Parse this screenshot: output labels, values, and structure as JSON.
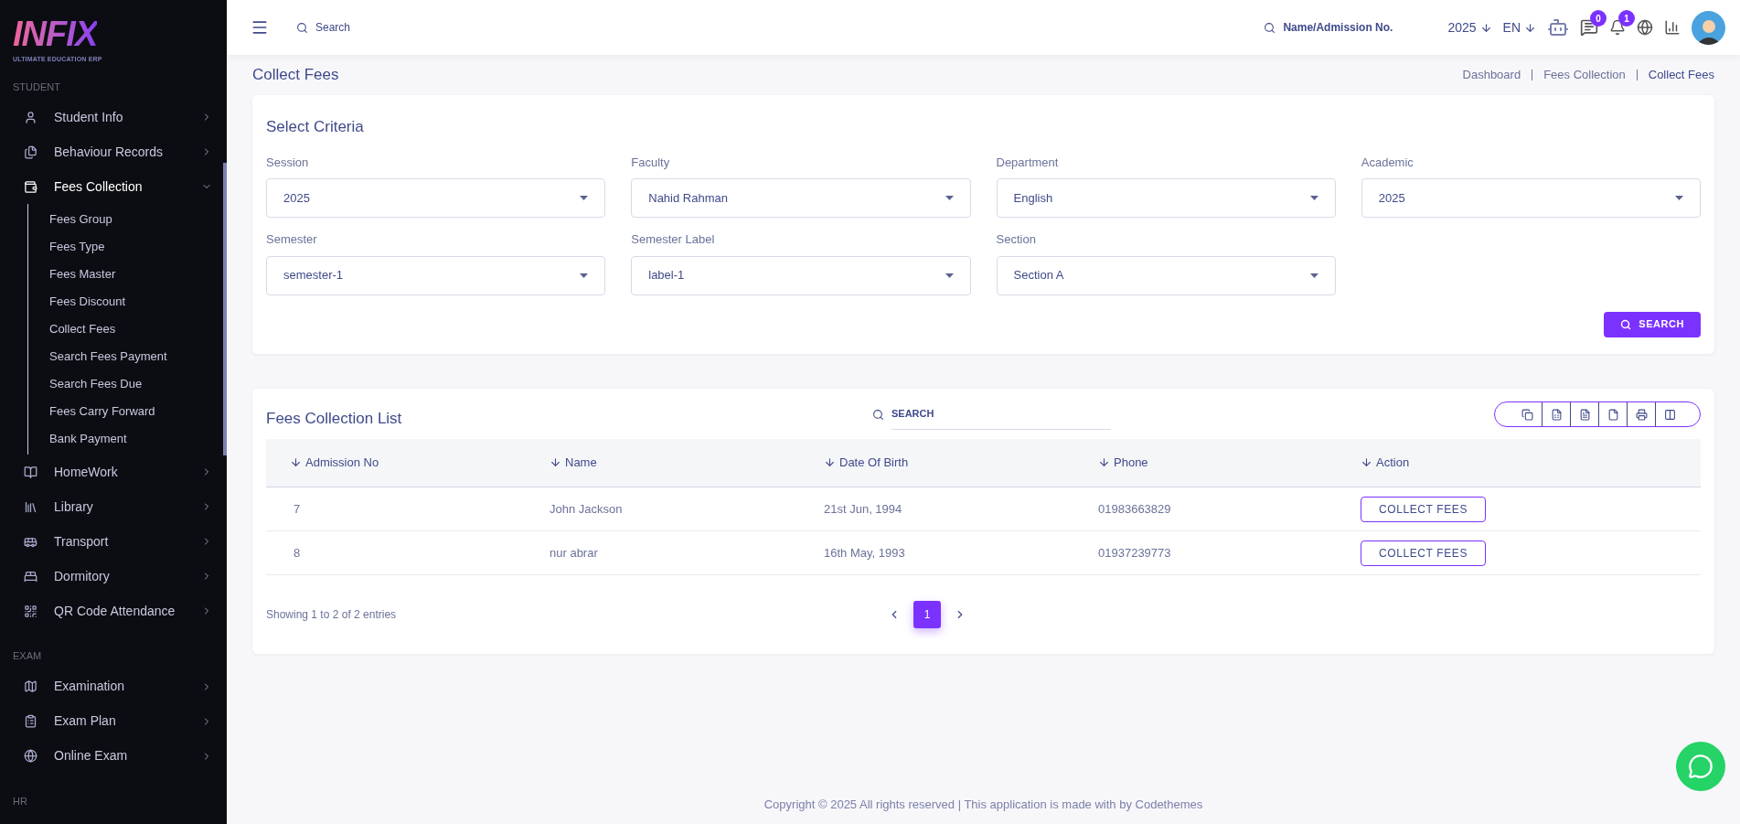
{
  "logo": {
    "name": "INFIX",
    "tagline": "ULTIMATE EDUCATION ERP"
  },
  "sidebar": {
    "sections": [
      {
        "label": "STUDENT",
        "items": [
          {
            "label": "Student Info",
            "selected": false,
            "expanded": false
          },
          {
            "label": "Behaviour Records",
            "selected": false,
            "expanded": false
          },
          {
            "label": "Fees Collection",
            "selected": true,
            "expanded": true,
            "children": [
              {
                "label": "Fees Group"
              },
              {
                "label": "Fees Type"
              },
              {
                "label": "Fees Master"
              },
              {
                "label": "Fees Discount"
              },
              {
                "label": "Collect Fees"
              },
              {
                "label": "Search Fees Payment"
              },
              {
                "label": "Search Fees Due"
              },
              {
                "label": "Fees Carry Forward"
              },
              {
                "label": "Bank Payment"
              }
            ]
          },
          {
            "label": "HomeWork",
            "selected": false,
            "expanded": false
          },
          {
            "label": "Library",
            "selected": false,
            "expanded": false
          },
          {
            "label": "Transport",
            "selected": false,
            "expanded": false
          },
          {
            "label": "Dormitory",
            "selected": false,
            "expanded": false
          },
          {
            "label": "QR Code Attendance",
            "selected": false,
            "expanded": false
          }
        ]
      },
      {
        "label": "EXAM",
        "items": [
          {
            "label": "Examination",
            "selected": false,
            "expanded": false
          },
          {
            "label": "Exam Plan",
            "selected": false,
            "expanded": false
          },
          {
            "label": "Online Exam",
            "selected": false,
            "expanded": false
          }
        ]
      },
      {
        "label": "HR"
      }
    ]
  },
  "header": {
    "search": {
      "placeholder": "Search"
    },
    "student_search": {
      "placeholder": "Name/Admission No."
    },
    "year": "2025",
    "language": "EN",
    "messages_badge": "0",
    "notifications_badge": "1"
  },
  "page": {
    "title": "Collect Fees",
    "breadcrumbs": [
      "Dashboard",
      "Fees Collection",
      "Collect Fees"
    ]
  },
  "criteria": {
    "title": "Select Criteria",
    "fields": [
      {
        "label": "Session",
        "value": "2025"
      },
      {
        "label": "Faculty",
        "value": "Nahid Rahman"
      },
      {
        "label": "Department",
        "value": "English"
      },
      {
        "label": "Academic",
        "value": "2025"
      },
      {
        "label": "Semester",
        "value": "semester-1"
      },
      {
        "label": "Semester Label",
        "value": "label-1"
      },
      {
        "label": "Section",
        "value": "Section A"
      }
    ],
    "button": "SEARCH"
  },
  "list": {
    "title": "Fees Collection List",
    "search": {
      "placeholder": "SEARCH"
    },
    "columns": [
      "Admission No",
      "Name",
      "Date Of Birth",
      "Phone",
      "Action"
    ],
    "rows": [
      {
        "admission_no": "7",
        "name": "John Jackson",
        "dob": "21st Jun, 1994",
        "phone": "01983663829",
        "action": "COLLECT FEES"
      },
      {
        "admission_no": "8",
        "name": "nur abrar",
        "dob": "16th May, 1993",
        "phone": "01937239773",
        "action": "COLLECT FEES"
      }
    ],
    "summary": "Showing 1 to 2 of 2 entries",
    "pages": [
      {
        "label": "1",
        "selected": true
      }
    ]
  },
  "footer": "Copyright © 2025 All rights reserved | This application is made with by Codethemes"
}
